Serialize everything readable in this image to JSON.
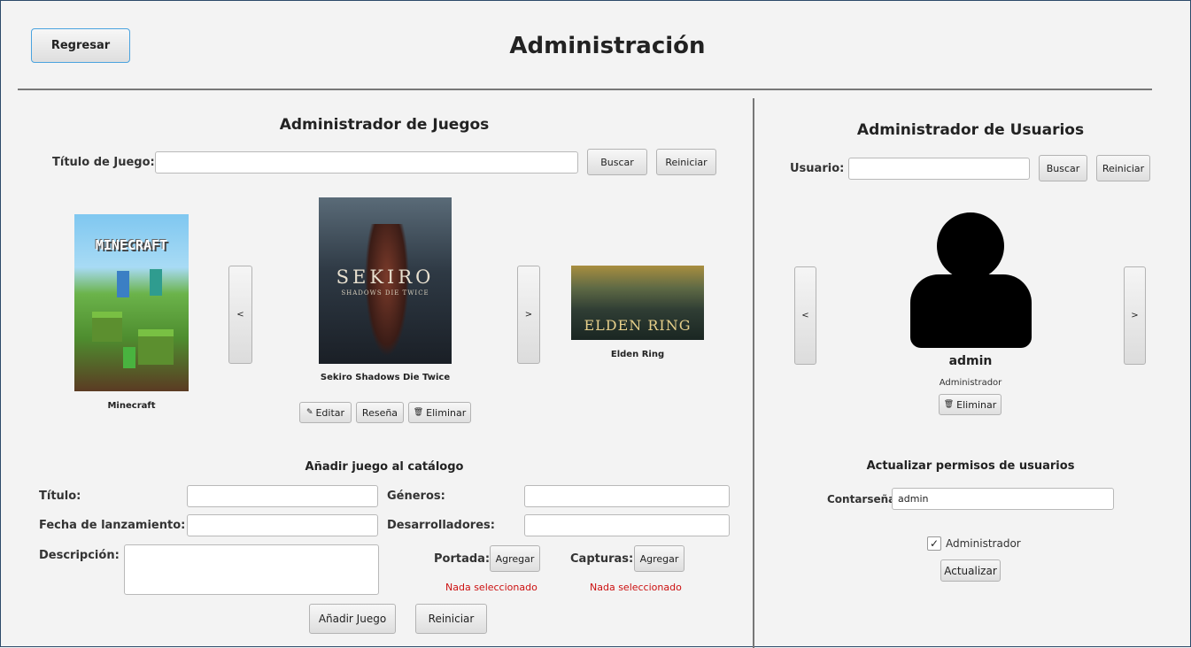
{
  "header": {
    "back_label": "Regresar",
    "title": "Administración"
  },
  "games": {
    "title": "Administrador de Juegos",
    "search_label": "Título de Juego:",
    "search_value": "",
    "search_button": "Buscar",
    "reset_button": "Reiniciar",
    "prev": "<",
    "next": ">",
    "items": [
      {
        "name": "Minecraft",
        "cover_text": "MINECRAFT"
      },
      {
        "name": "Sekiro Shadows Die Twice",
        "cover_text": "SEKIRO",
        "cover_sub": "SHADOWS DIE TWICE"
      },
      {
        "name": "Elden Ring",
        "cover_text": "ELDEN RING"
      }
    ],
    "actions": {
      "edit": "Editar",
      "review": "Reseña",
      "delete": "Eliminar"
    }
  },
  "add_game": {
    "title": "Añadir juego al catálogo",
    "fields": {
      "title_label": "Título:",
      "release_label": "Fecha de lanzamiento:",
      "description_label": "Descripción:",
      "genres_label": "Géneros:",
      "developers_label": "Desarrolladores:"
    },
    "cover_label": "Portada:",
    "screenshots_label": "Capturas:",
    "add_button": "Agregar",
    "cover_status": "Nada seleccionado",
    "screenshots_status": "Nada seleccionado",
    "submit_button": "Añadir Juego",
    "reset_button": "Reiniciar"
  },
  "users": {
    "title": "Administrador de Usuarios",
    "search_label": "Usuario:",
    "search_value": "",
    "search_button": "Buscar",
    "reset_button": "Reiniciar",
    "prev": "<",
    "next": ">",
    "current": {
      "username": "admin",
      "role": "Administrador"
    },
    "delete_button": "Eliminar"
  },
  "permissions": {
    "title": "Actualizar permisos de usuarios",
    "password_label": "Contarseña:",
    "password_value": "admin",
    "admin_checkbox_label": "Administrador",
    "admin_checked": true,
    "update_button": "Actualizar"
  }
}
